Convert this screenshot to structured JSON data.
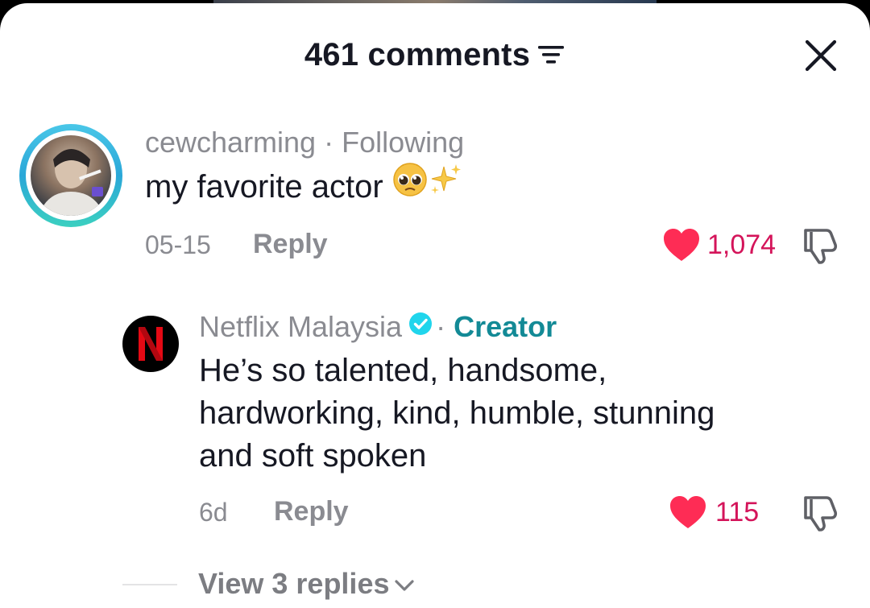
{
  "header": {
    "comment_count_label": "461 comments"
  },
  "comments": [
    {
      "username": "cewcharming",
      "relation": "Following",
      "text": "my favorite actor",
      "emojis": [
        "pleading-face-emoji",
        "sparkles-emoji"
      ],
      "date": "05-15",
      "reply_label": "Reply",
      "like_count": "1,074"
    },
    {
      "username": "Netflix Malaysia",
      "relation": "Creator",
      "verified": true,
      "text_lines": [
        "He’s so talented, handsome,",
        "hardworking, kind, humble, stunning",
        "and soft spoken"
      ],
      "date": "6d",
      "reply_label": "Reply",
      "like_count": "115"
    }
  ],
  "view_replies_label": "View 3 replies",
  "colors": {
    "like": "#fe2c55",
    "like_count": "#d4145a",
    "creator": "#138a96",
    "muted": "#8a8b91",
    "text": "#161823",
    "avatar_ring": "#2aa7d8"
  }
}
